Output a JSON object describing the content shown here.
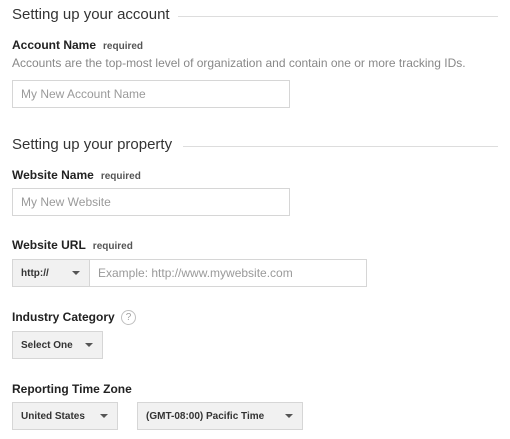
{
  "account_section": {
    "title": "Setting up your account",
    "account_name": {
      "label": "Account Name",
      "required": "required",
      "help": "Accounts are the top-most level of organization and contain one or more tracking IDs.",
      "placeholder": "My New Account Name",
      "value": ""
    }
  },
  "property_section": {
    "title": "Setting up your property",
    "website_name": {
      "label": "Website Name",
      "required": "required",
      "placeholder": "My New Website",
      "value": ""
    },
    "website_url": {
      "label": "Website URL",
      "required": "required",
      "protocol_selected": "http://",
      "placeholder": "Example: http://www.mywebsite.com",
      "value": ""
    },
    "industry_category": {
      "label": "Industry Category",
      "help_icon": "?",
      "selected": "Select One"
    },
    "reporting_time_zone": {
      "label": "Reporting Time Zone",
      "country_selected": "United States",
      "zone_selected": "(GMT-08:00) Pacific Time"
    }
  },
  "colors": {
    "rule": "#dddddd",
    "input_border": "#d6d6d6",
    "dropdown_bg": "#f1f1f1",
    "placeholder": "#9a9a9a",
    "help_text": "#888888"
  },
  "icons": {
    "dropdown_caret": "chevron-down-icon",
    "help": "help-icon"
  }
}
